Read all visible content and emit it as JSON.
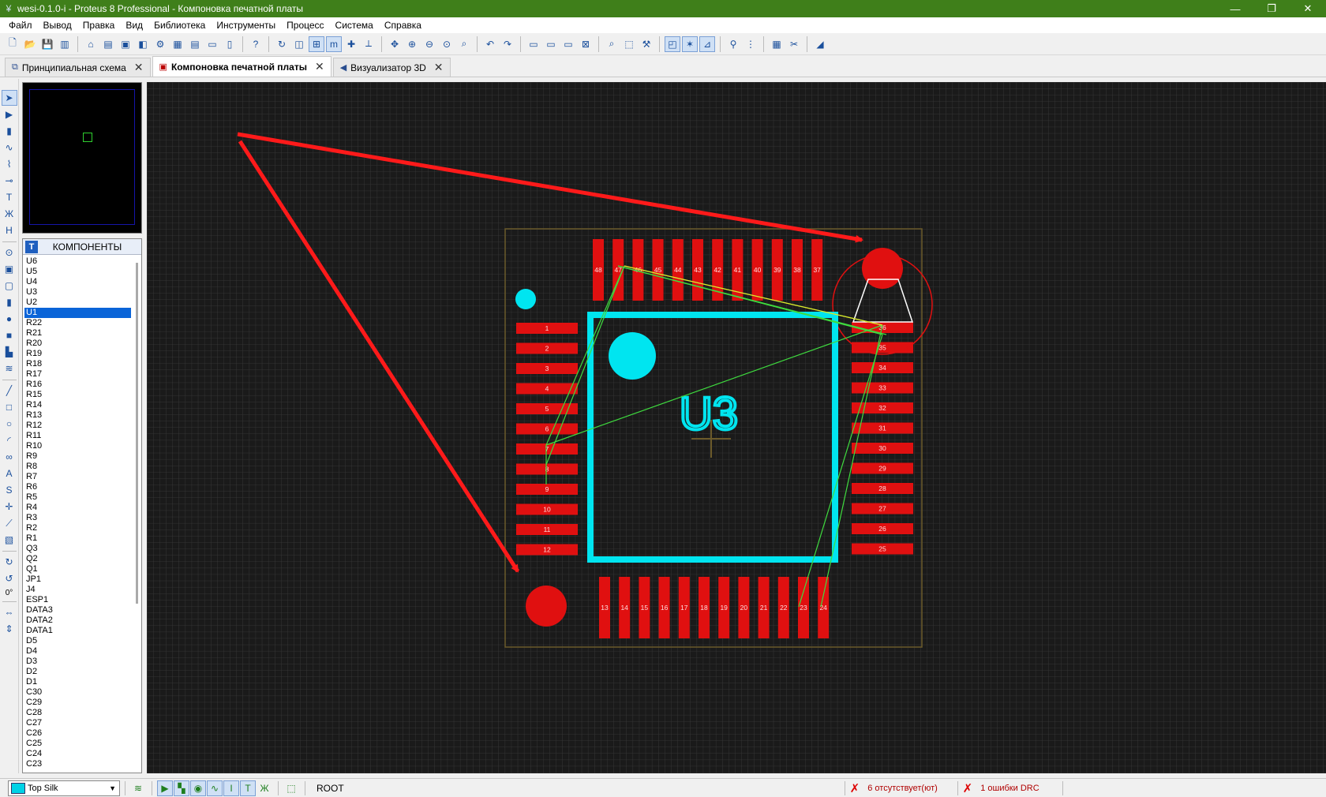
{
  "window": {
    "title": "wesi-0.1.0-i - Proteus 8 Professional - Компоновка печатной платы",
    "controls": [
      "—",
      "❐",
      "✕"
    ]
  },
  "menu": [
    "Файл",
    "Вывод",
    "Правка",
    "Вид",
    "Библиотека",
    "Инструменты",
    "Процесс",
    "Система",
    "Справка"
  ],
  "tabs": [
    {
      "label": "Принципиальная схема",
      "active": false
    },
    {
      "label": "Компоновка печатной платы",
      "active": true
    },
    {
      "label": "Визуализатор 3D",
      "active": false
    }
  ],
  "component_panel": {
    "header_icon": "T",
    "title": "КОМПОНЕНТЫ",
    "items": [
      "U6",
      "U5",
      "U4",
      "U3",
      "U2",
      "U1",
      "R22",
      "R21",
      "R20",
      "R19",
      "R18",
      "R17",
      "R16",
      "R15",
      "R14",
      "R13",
      "R12",
      "R11",
      "R10",
      "R9",
      "R8",
      "R7",
      "R6",
      "R5",
      "R4",
      "R3",
      "R2",
      "R1",
      "Q3",
      "Q2",
      "Q1",
      "JP1",
      "J4",
      "ESP1",
      "DATA3",
      "DATA2",
      "DATA1",
      "D5",
      "D4",
      "D3",
      "D2",
      "D1",
      "C30",
      "C29",
      "C28",
      "C27",
      "C26",
      "C25",
      "C24",
      "C23"
    ],
    "selected": "U1"
  },
  "left_strip": {
    "angle": "0°"
  },
  "pcb": {
    "component_label": "U3",
    "pins_top": [
      "48",
      "47",
      "46",
      "45",
      "44",
      "43",
      "42",
      "41",
      "40",
      "39",
      "38",
      "37"
    ],
    "pins_left": [
      "1",
      "2",
      "3",
      "4",
      "5",
      "6",
      "7",
      "8",
      "9",
      "10",
      "11",
      "12"
    ],
    "pins_bottom": [
      "13",
      "14",
      "15",
      "16",
      "17",
      "18",
      "19",
      "20",
      "21",
      "22",
      "23",
      "24"
    ],
    "pins_right": [
      "36",
      "35",
      "34",
      "33",
      "32",
      "31",
      "30",
      "29",
      "28",
      "27",
      "26",
      "25"
    ],
    "colors": {
      "background": "#1a1a1a",
      "grid": "#3a3a3a",
      "pad": "#e01010",
      "silk": "#00e5f0",
      "ratsnest": "#3fdc3f",
      "annotation": "#ff1a1a",
      "outline": "#6b5a2a"
    }
  },
  "statusbar": {
    "layer": "Top Silk",
    "root": "ROOT",
    "missing": "6 отсутствует(ют)",
    "drc": "1 ошибки DRC"
  }
}
